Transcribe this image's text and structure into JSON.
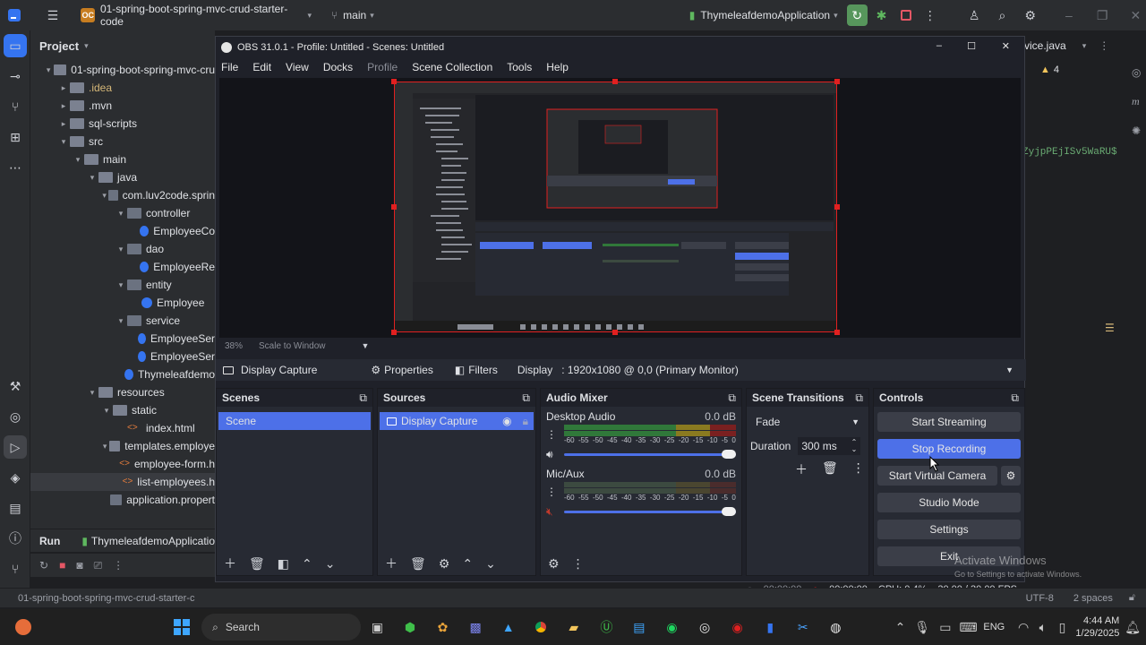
{
  "ide": {
    "project_badge": "OC",
    "project_name": "01-spring-boot-spring-mvc-crud-starter-code",
    "branch": "main",
    "run_config": "ThymeleafdemoApplication",
    "editor_tab": "vice.java",
    "warning_count": "4",
    "code_fragment_1": "ZyjpPEjISv5WaRU$",
    "project_panel_title": "Project",
    "tree": [
      {
        "indent": 0,
        "arrow": "▾",
        "icon": "folder",
        "label": "01-spring-boot-spring-mvc-cru"
      },
      {
        "indent": 1,
        "arrow": "▸",
        "icon": "folder",
        "label": ".idea",
        "cls": "ora"
      },
      {
        "indent": 1,
        "arrow": "▸",
        "icon": "folder",
        "label": ".mvn"
      },
      {
        "indent": 1,
        "arrow": "▸",
        "icon": "folder",
        "label": "sql-scripts"
      },
      {
        "indent": 1,
        "arrow": "▾",
        "icon": "folder",
        "label": "src"
      },
      {
        "indent": 2,
        "arrow": "▾",
        "icon": "folder",
        "label": "main"
      },
      {
        "indent": 3,
        "arrow": "▾",
        "icon": "folder",
        "label": "java"
      },
      {
        "indent": 4,
        "arrow": "▾",
        "icon": "pkg",
        "label": "com.luv2code.sprin"
      },
      {
        "indent": 5,
        "arrow": "▾",
        "icon": "pkg",
        "label": "controller"
      },
      {
        "indent": 6,
        "arrow": "",
        "icon": "class",
        "label": "EmployeeCo"
      },
      {
        "indent": 5,
        "arrow": "▾",
        "icon": "pkg",
        "label": "dao"
      },
      {
        "indent": 6,
        "arrow": "",
        "icon": "class",
        "label": "EmployeeRe"
      },
      {
        "indent": 5,
        "arrow": "▾",
        "icon": "pkg",
        "label": "entity"
      },
      {
        "indent": 6,
        "arrow": "",
        "icon": "class",
        "label": "Employee"
      },
      {
        "indent": 5,
        "arrow": "▾",
        "icon": "pkg",
        "label": "service"
      },
      {
        "indent": 6,
        "arrow": "",
        "icon": "class",
        "label": "EmployeeSer"
      },
      {
        "indent": 6,
        "arrow": "",
        "icon": "class",
        "label": "EmployeeSer"
      },
      {
        "indent": 5,
        "arrow": "",
        "icon": "class",
        "label": "Thymeleafdemo"
      },
      {
        "indent": 3,
        "arrow": "▾",
        "icon": "folder",
        "label": "resources"
      },
      {
        "indent": 4,
        "arrow": "▾",
        "icon": "folder",
        "label": "static"
      },
      {
        "indent": 5,
        "arrow": "",
        "icon": "html",
        "label": "index.html"
      },
      {
        "indent": 4,
        "arrow": "▾",
        "icon": "folder",
        "label": "templates.employe"
      },
      {
        "indent": 5,
        "arrow": "",
        "icon": "html",
        "label": "employee-form.h"
      },
      {
        "indent": 5,
        "arrow": "",
        "icon": "html",
        "label": "list-employees.h",
        "selected": true
      },
      {
        "indent": 4,
        "arrow": "",
        "icon": "pkg",
        "label": "application.propert"
      }
    ],
    "run_label": "Run",
    "run_tab": "ThymeleafdemoApplicatio",
    "status_path": "01-spring-boot-spring-mvc-crud-starter-c",
    "status_encoding": "UTF-8",
    "status_indent": "2 spaces"
  },
  "obs": {
    "title": "OBS 31.0.1 - Profile: Untitled - Scenes: Untitled",
    "menu": [
      "File",
      "Edit",
      "View",
      "Docks",
      "Profile",
      "Scene Collection",
      "Tools",
      "Help"
    ],
    "zoom": "38%",
    "scale_mode": "Scale to Window",
    "source_name": "Display Capture",
    "properties_label": "Properties",
    "filters_label": "Filters",
    "display_label": "Display",
    "display_value": ": 1920x1080 @ 0,0 (Primary Monitor)",
    "scenes": {
      "title": "Scenes",
      "items": [
        "Scene"
      ]
    },
    "sources": {
      "title": "Sources",
      "items": [
        "Display Capture"
      ]
    },
    "audio_mixer": {
      "title": "Audio Mixer",
      "scale": [
        "-60",
        "-55",
        "-50",
        "-45",
        "-40",
        "-35",
        "-30",
        "-25",
        "-20",
        "-15",
        "-10",
        "-5",
        "0"
      ],
      "channels": [
        {
          "name": "Desktop Audio",
          "db": "0.0 dB",
          "muted": false
        },
        {
          "name": "Mic/Aux",
          "db": "0.0 dB",
          "muted": true
        }
      ]
    },
    "transitions": {
      "title": "Scene Transitions",
      "type": "Fade",
      "duration_label": "Duration",
      "duration_value": "300 ms"
    },
    "controls": {
      "title": "Controls",
      "buttons": [
        "Start Streaming",
        "Stop Recording",
        "Start Virtual Camera",
        "Studio Mode",
        "Settings",
        "Exit"
      ],
      "active": "Stop Recording"
    },
    "status": {
      "stream_time": "00:00:00",
      "rec_time": "00:00:00",
      "cpu": "CPU: 0.4%",
      "fps": "30.00 / 30.00 FPS"
    }
  },
  "windows": {
    "activate_title": "Activate Windows",
    "activate_sub": "Go to Settings to activate Windows.",
    "search": "Search",
    "lang": "ENG",
    "time": "4:44 AM",
    "date": "1/29/2025"
  }
}
